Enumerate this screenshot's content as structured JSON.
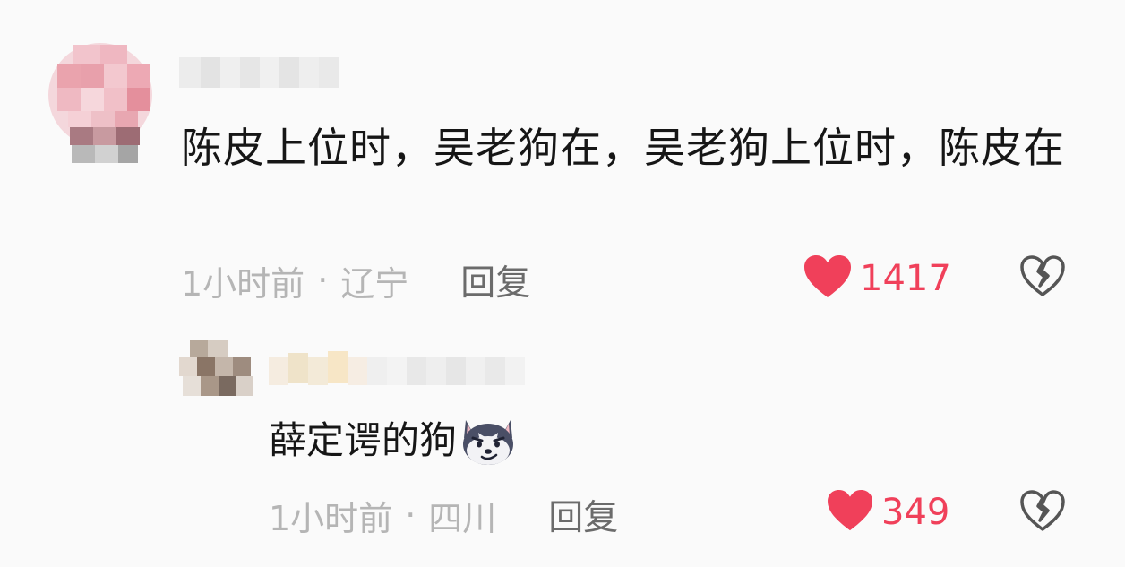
{
  "comment": {
    "text": "陈皮上位时，吴老狗在，吴老狗上位时，陈皮在",
    "time": "1小时前",
    "separator": "·",
    "location": "辽宁",
    "reply_label": "回复",
    "likes": "1417"
  },
  "reply": {
    "text": "薛定谔的狗",
    "emoji": "dog-face-emoji",
    "time": "1小时前",
    "separator": "·",
    "location": "四川",
    "reply_label": "回复",
    "likes": "349"
  },
  "colors": {
    "background": "#fafafa",
    "text": "#161616",
    "meta": "#b5b5b5",
    "reply_button": "#6b6b6b",
    "like": "#f0405a",
    "dislike_outline": "#555555"
  },
  "icons": {
    "like": "heart-filled-icon",
    "dislike": "broken-heart-outline-icon"
  }
}
